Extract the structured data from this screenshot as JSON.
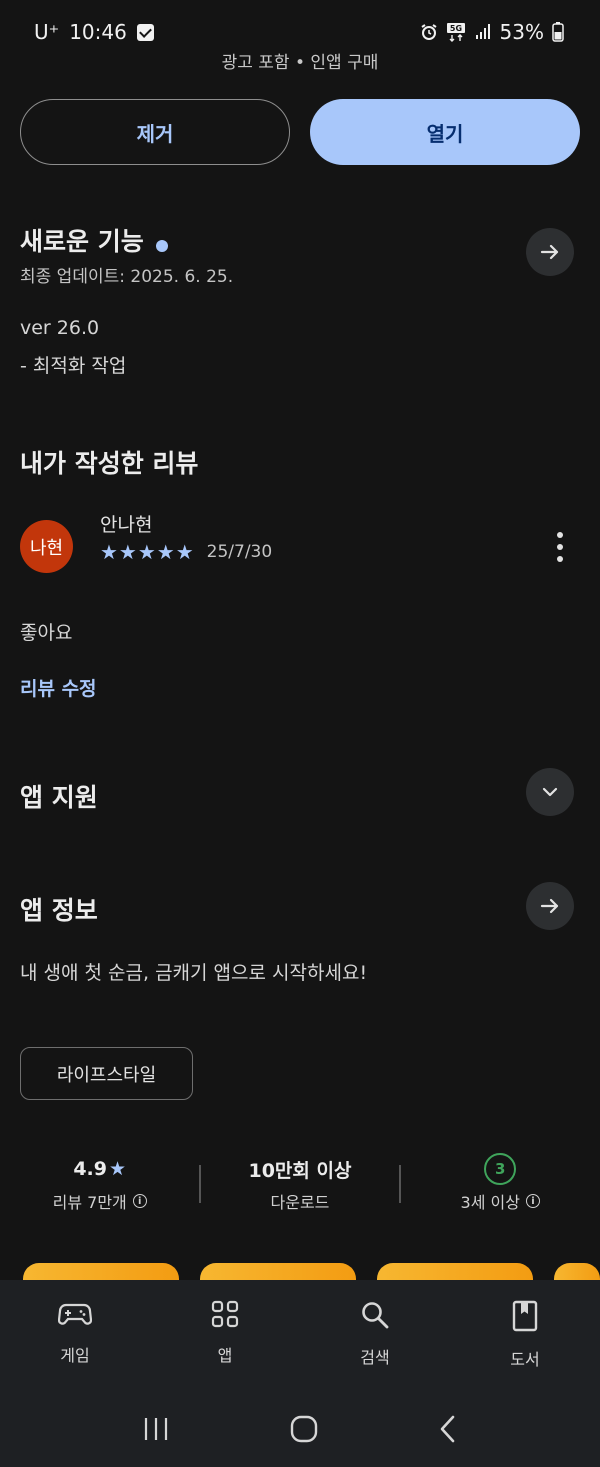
{
  "status_bar": {
    "carrier": "U⁺",
    "time": "10:46",
    "battery": "53%"
  },
  "app_notice": "광고 포함  •  인앱 구매",
  "actions": {
    "remove_label": "제거",
    "open_label": "열기"
  },
  "whats_new": {
    "title": "새로운 기능",
    "updated": "최종 업데이트: 2025. 6. 25.",
    "version": "ver 26.0",
    "notes": "- 최적화 작업"
  },
  "my_review": {
    "title": "내가 작성한 리뷰",
    "avatar_text": "나현",
    "author": "안나현",
    "rating": 5,
    "stars": "★★★★★",
    "date": "25/7/30",
    "text": "좋아요",
    "edit_label": "리뷰 수정"
  },
  "app_support": {
    "title": "앱 지원"
  },
  "app_info": {
    "title": "앱 정보",
    "description": "내 생애 첫 순금, 금캐기 앱으로 시작하세요!",
    "category_chip": "라이프스타일"
  },
  "stats": {
    "rating_value": "4.9",
    "rating_star": "★",
    "rating_label": "리뷰 7만개",
    "downloads_value": "10만회 이상",
    "downloads_label": "다운로드",
    "age_value": "3",
    "age_label": "3세 이상"
  },
  "bottom_nav": {
    "items": [
      {
        "label": "게임",
        "icon": "gamepad-icon"
      },
      {
        "label": "앱",
        "icon": "apps-grid-icon"
      },
      {
        "label": "검색",
        "icon": "search-icon"
      },
      {
        "label": "도서",
        "icon": "book-icon"
      }
    ]
  },
  "colors": {
    "accent": "#a8c7fa",
    "background": "#141414",
    "avatar": "#c2360b",
    "age_badge": "#3fa45b"
  }
}
